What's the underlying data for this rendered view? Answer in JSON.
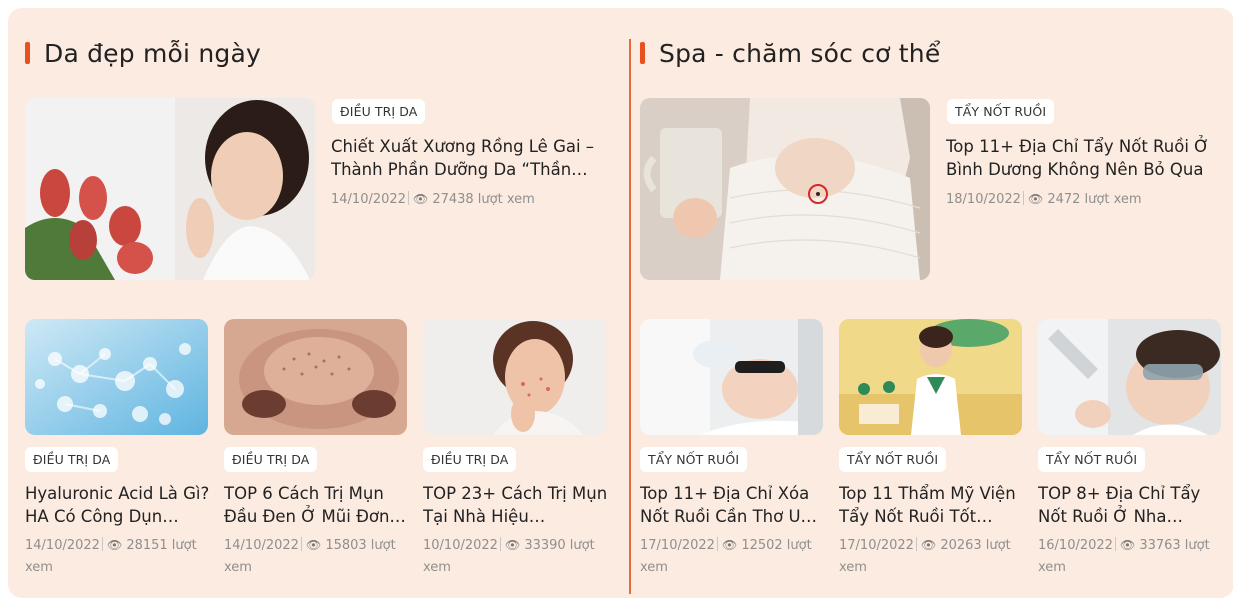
{
  "left": {
    "title": "Da đẹp mỗi ngày",
    "featured": {
      "category": "ĐIỀU TRỊ DA",
      "title": "Chiết Xuất Xương Rồng Lê Gai – Thành Phần Dưỡng Da “Thần…",
      "date": "14/10/2022",
      "views": "27438 lượt xem"
    },
    "cards": [
      {
        "category": "ĐIỀU TRỊ DA",
        "title": "Hyaluronic Acid Là Gì? HA Có Công Dụn…",
        "date": "14/10/2022",
        "views_line1": "28151 lượt",
        "views_line2": "xem"
      },
      {
        "category": "ĐIỀU TRỊ DA",
        "title": "TOP 6 Cách Trị Mụn Đầu Đen Ở Mũi Đơn…",
        "date": "14/10/2022",
        "views_line1": "15803 lượt",
        "views_line2": "xem"
      },
      {
        "category": "ĐIỀU TRỊ DA",
        "title": "TOP 23+ Cách Trị Mụn Tại Nhà Hiệu…",
        "date": "10/10/2022",
        "views_line1": "33390 lượt",
        "views_line2": "xem"
      }
    ]
  },
  "right": {
    "title": "Spa - chăm sóc cơ thể",
    "featured": {
      "category": "TẨY NỐT RUỒI",
      "title": "Top 11+ Địa Chỉ Tẩy Nốt Ruồi Ở Bình Dương Không Nên Bỏ Qua",
      "date": "18/10/2022",
      "views": "2472 lượt xem"
    },
    "cards": [
      {
        "category": "TẨY NỐT RUỒI",
        "title": "Top 11+ Địa Chỉ Xóa Nốt Ruồi Cần Thơ U…",
        "date": "17/10/2022",
        "views_line1": "12502 lượt",
        "views_line2": "xem"
      },
      {
        "category": "TẨY NỐT RUỒI",
        "title": "Top 11 Thẩm Mỹ Viện Tẩy Nốt Ruồi Tốt…",
        "date": "17/10/2022",
        "views_line1": "20263 lượt",
        "views_line2": "xem"
      },
      {
        "category": "TẨY NỐT RUỒI",
        "title": "TOP 8+ Địa Chỉ Tẩy Nốt Ruồi Ở Nha…",
        "date": "16/10/2022",
        "views_line1": "33763 lượt",
        "views_line2": "xem"
      }
    ]
  },
  "colors": {
    "panel_bg": "#fcebe0",
    "accent": "#e8501d",
    "text": "#222222",
    "meta": "#8f8f8f"
  },
  "icons": {
    "views": "eye-icon"
  }
}
